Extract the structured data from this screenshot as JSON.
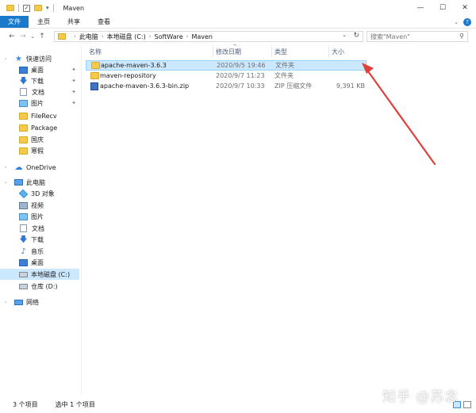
{
  "window": {
    "title": "Maven",
    "controls": {
      "minimize": "—",
      "maximize": "☐",
      "close": "✕"
    }
  },
  "ribbon": {
    "tabs": [
      "文件",
      "主页",
      "共享",
      "查看"
    ],
    "expand": "⌄",
    "help": "?"
  },
  "address": {
    "back": "←",
    "forward": "→",
    "recent": "⌄",
    "up": "↑",
    "crumbs": [
      "此电脑",
      "本地磁盘 (C:)",
      "SoftWare",
      "Maven"
    ],
    "separator": "›",
    "dropdown": "⌄",
    "refresh": "↻"
  },
  "search": {
    "placeholder": "搜索\"Maven\"",
    "icon": "⚲"
  },
  "nav": {
    "quick_access": "快速访问",
    "items": [
      {
        "label": "桌面",
        "icon": "desktop-icon",
        "pinned": true
      },
      {
        "label": "下载",
        "icon": "download-icon",
        "pinned": true
      },
      {
        "label": "文档",
        "icon": "document-icon",
        "pinned": true
      },
      {
        "label": "图片",
        "icon": "picture-icon",
        "pinned": true
      },
      {
        "label": "FileRecv",
        "icon": "folder-icon",
        "pinned": false
      },
      {
        "label": "Package",
        "icon": "folder-icon",
        "pinned": false
      },
      {
        "label": "国庆",
        "icon": "folder-icon",
        "pinned": false
      },
      {
        "label": "寒假",
        "icon": "folder-icon",
        "pinned": false
      }
    ],
    "onedrive": "OneDrive",
    "this_pc": "此电脑",
    "pc_items": [
      {
        "label": "3D 对象",
        "icon": "3d-objects-icon"
      },
      {
        "label": "视频",
        "icon": "video-icon"
      },
      {
        "label": "图片",
        "icon": "picture-icon"
      },
      {
        "label": "文档",
        "icon": "document-icon"
      },
      {
        "label": "下载",
        "icon": "download-icon"
      },
      {
        "label": "音乐",
        "icon": "music-icon"
      },
      {
        "label": "桌面",
        "icon": "desktop-icon"
      },
      {
        "label": "本地磁盘 (C:)",
        "icon": "drive-icon",
        "selected": true
      },
      {
        "label": "仓库 (D:)",
        "icon": "drive-icon"
      }
    ],
    "network": "网络"
  },
  "columns": {
    "name": "名称",
    "date": "修改日期",
    "type": "类型",
    "size": "大小",
    "sort_arrow": "^"
  },
  "files": [
    {
      "name": "apache-maven-3.6.3",
      "date": "2020/9/5 19:46",
      "type": "文件夹",
      "size": "",
      "icon": "folder-icon",
      "selected": true
    },
    {
      "name": "maven-repository",
      "date": "2020/9/7 11:23",
      "type": "文件夹",
      "size": "",
      "icon": "folder-icon",
      "selected": false
    },
    {
      "name": "apache-maven-3.6.3-bin.zip",
      "date": "2020/9/7 10:33",
      "type": "ZIP 压缩文件",
      "size": "9,391 KB",
      "icon": "zip-icon",
      "selected": false
    }
  ],
  "status": {
    "count": "3 个项目",
    "selected": "选中 1 个项目"
  },
  "watermark": "知乎 @苏念",
  "annotation_color": "#e0403a"
}
